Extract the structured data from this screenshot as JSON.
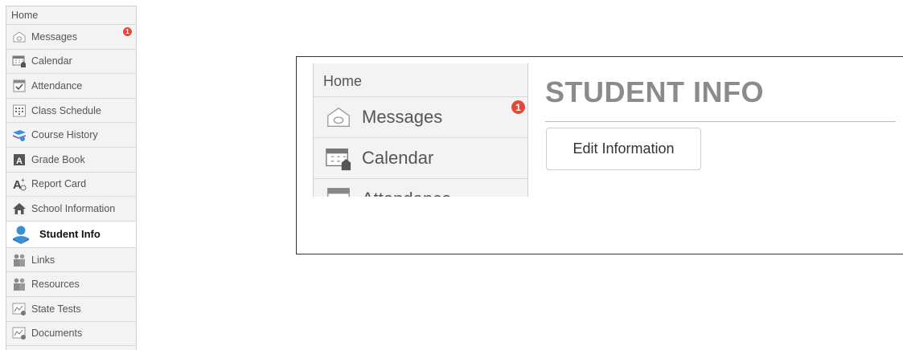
{
  "sidebar": {
    "home_label": "Home",
    "items": [
      {
        "label": "Messages",
        "icon": "envelope-icon",
        "badge": "1"
      },
      {
        "label": "Calendar",
        "icon": "calendar-icon"
      },
      {
        "label": "Attendance",
        "icon": "attendance-icon"
      },
      {
        "label": "Class Schedule",
        "icon": "schedule-icon"
      },
      {
        "label": "Course History",
        "icon": "books-icon"
      },
      {
        "label": "Grade Book",
        "icon": "gradebook-icon"
      },
      {
        "label": "Report Card",
        "icon": "report-card-icon"
      },
      {
        "label": "School Information",
        "icon": "school-icon"
      },
      {
        "label": "Student Info",
        "icon": "student-icon",
        "active": true
      },
      {
        "label": "Links",
        "icon": "people-icon"
      },
      {
        "label": "Resources",
        "icon": "people-icon"
      },
      {
        "label": "State Tests",
        "icon": "chart-icon"
      },
      {
        "label": "Documents",
        "icon": "chart-icon"
      }
    ]
  },
  "zoom": {
    "home_label": "Home",
    "items": [
      {
        "label": "Messages",
        "badge": "1"
      },
      {
        "label": "Calendar"
      },
      {
        "label": "Attendance"
      }
    ],
    "title": "STUDENT INFO",
    "edit_button_label": "Edit Information"
  },
  "colors": {
    "badge": "#e04b3c",
    "title": "#8b8b8b",
    "sidebar_bg": "#f3f3f3",
    "student_icon": "#3b8fd4"
  }
}
